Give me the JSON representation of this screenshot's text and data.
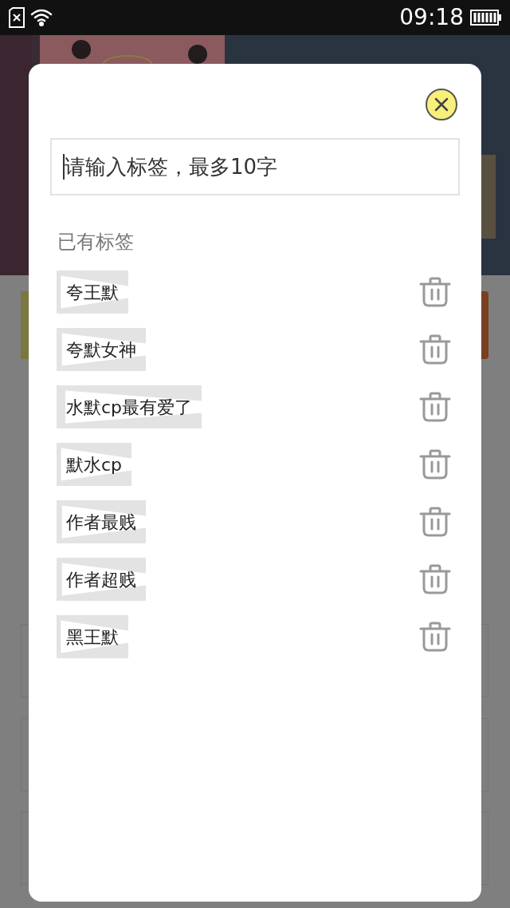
{
  "status_bar": {
    "time": "09:18"
  },
  "dialog": {
    "input": {
      "placeholder": "请输入标签，最多10字"
    },
    "section_title": "已有标签",
    "tags": [
      {
        "label": "夸王默"
      },
      {
        "label": "夸默女神"
      },
      {
        "label": "水默cp最有爱了"
      },
      {
        "label": "默水cp"
      },
      {
        "label": "作者最贱"
      },
      {
        "label": "作者超贱"
      },
      {
        "label": "黑王默"
      }
    ]
  }
}
